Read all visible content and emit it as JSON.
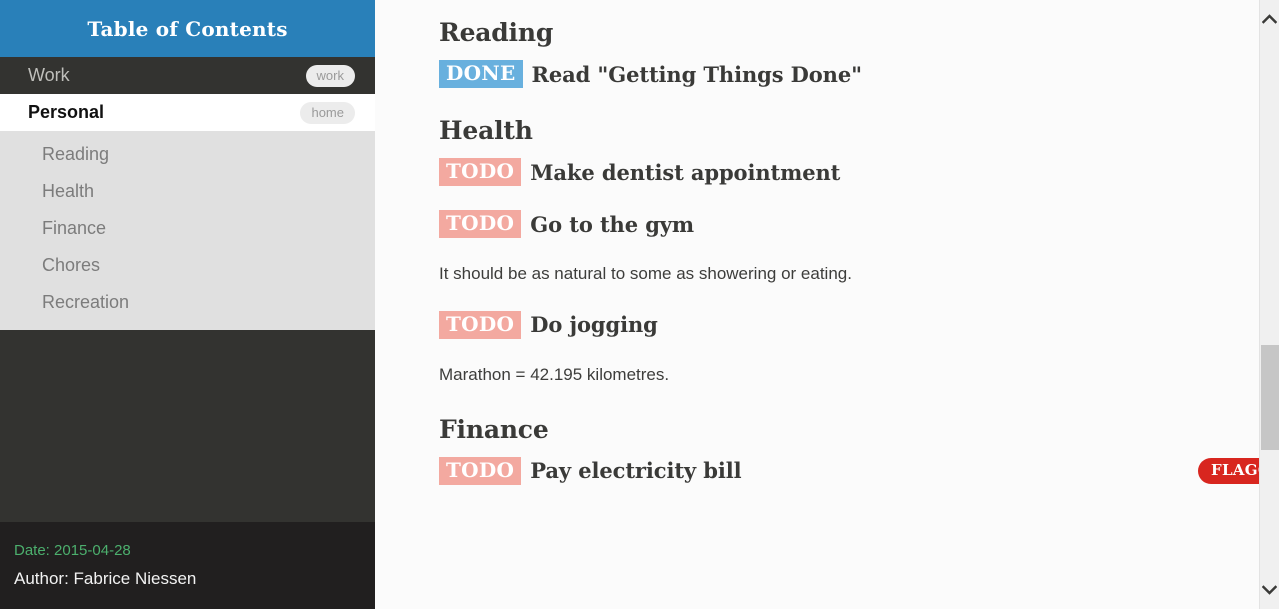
{
  "sidebar": {
    "header_title": "Table of Contents",
    "top_items": [
      {
        "label": "Work",
        "tag": "work",
        "selected": false
      },
      {
        "label": "Personal",
        "tag": "home",
        "selected": true
      }
    ],
    "sub_items": [
      {
        "label": "Reading"
      },
      {
        "label": "Health"
      },
      {
        "label": "Finance"
      },
      {
        "label": "Chores"
      },
      {
        "label": "Recreation"
      }
    ],
    "footer": {
      "date": "Date: 2015-04-28",
      "author": "Author: Fabrice Niessen"
    }
  },
  "content": {
    "sections": [
      {
        "heading": "Reading",
        "items": [
          {
            "kind": "task",
            "keyword": "DONE",
            "title": "Read \"Getting Things Done\"",
            "flag": null
          }
        ]
      },
      {
        "heading": "Health",
        "items": [
          {
            "kind": "task",
            "keyword": "TODO",
            "title": "Make dentist appointment",
            "flag": null
          },
          {
            "kind": "task",
            "keyword": "TODO",
            "title": "Go to the gym",
            "flag": null
          },
          {
            "kind": "para",
            "text": "It should be as natural to some as showering or eating."
          },
          {
            "kind": "task",
            "keyword": "TODO",
            "title": "Do jogging",
            "flag": null
          },
          {
            "kind": "para",
            "text": "Marathon = 42.195 kilometres."
          }
        ]
      },
      {
        "heading": "Finance",
        "items": [
          {
            "kind": "task",
            "keyword": "TODO",
            "title": "Pay electricity bill",
            "flag": "FLAGGED"
          }
        ]
      }
    ]
  },
  "scrollbar": {
    "up_icon": "chevron-up-icon",
    "down_icon": "chevron-down-icon"
  },
  "colors": {
    "header_blue": "#2980b9",
    "sidebar_dark": "#333330",
    "sidebar_footer": "#211f1f",
    "sublist_gray": "#e0e0e0",
    "todo_badge": "#f3a9a0",
    "done_badge": "#68b0de",
    "flagged_badge": "#d8261f",
    "date_green": "#4caf6d"
  }
}
